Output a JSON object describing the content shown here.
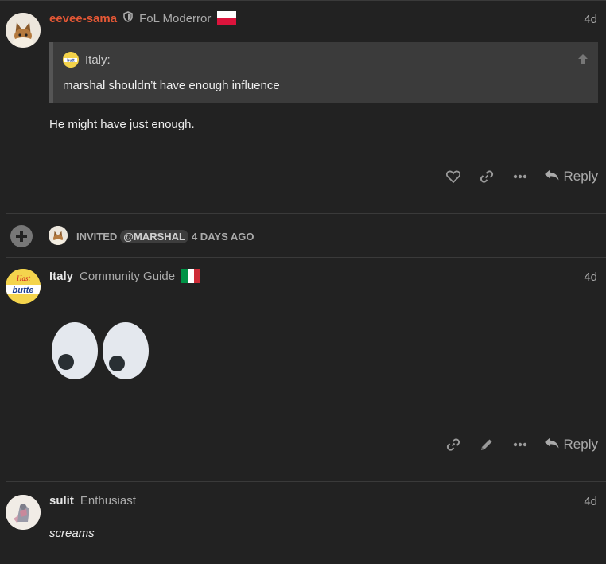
{
  "posts": [
    {
      "username": "eevee-sama",
      "user_title": "FoL Moderror",
      "date": "4d",
      "quote": {
        "author": "Italy:",
        "text": "marshal shouldn’t have enough influence"
      },
      "body": "He might have just enough.",
      "reply_label": "Reply"
    },
    {
      "username": "Italy",
      "user_title": "Community Guide",
      "date": "4d",
      "reply_label": "Reply"
    },
    {
      "username": "sulit",
      "user_title": "Enthusiast",
      "date": "4d",
      "body": "screams"
    }
  ],
  "small_action": {
    "prefix": "INVITED",
    "mention": "@MARSHAL",
    "suffix": "4 DAYS AGO"
  },
  "colors": {
    "background": "#222222",
    "moderator_name": "#e45735",
    "muted": "#aaaaaa",
    "quote_bg": "#3b3b3b"
  },
  "icons": [
    "shield-icon",
    "heart-icon",
    "link-icon",
    "ellipsis-icon",
    "reply-icon",
    "arrow-up-icon",
    "plus-icon",
    "pencil-icon",
    "poland-flag",
    "italy-flag"
  ]
}
